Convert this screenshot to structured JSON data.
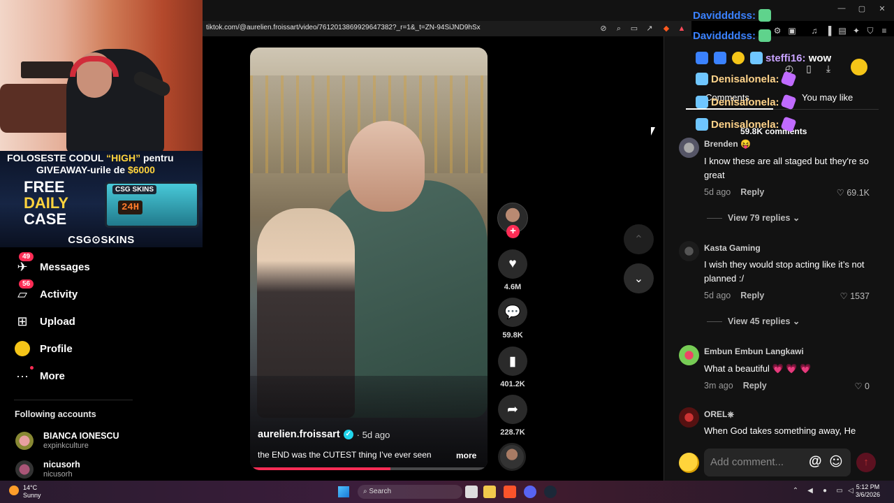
{
  "browser": {
    "url": "tiktok.com/@aurelien.froissart/video/7612013869929647382?_r=1&_t=ZN-94SiJND9hSx"
  },
  "stream_overlay": {
    "promo_line1_prefix": "FOLOSESTE CODUL ",
    "promo_code": "“HIGH”",
    "promo_line1_suffix": " pentru",
    "promo_line2_prefix": "GIVEAWAY-urile de ",
    "promo_amount": "$6000",
    "free_1": "FREE",
    "free_2": "DAILY",
    "free_3": "CASE",
    "crate_tag": "CSG SKINS",
    "crate_timer": "24H",
    "brand": "CSG⊙SKINS"
  },
  "sidebar": {
    "items": [
      {
        "label": "Messages",
        "badge": "49",
        "icon": "messages-icon"
      },
      {
        "label": "Activity",
        "badge": "56",
        "icon": "activity-icon"
      },
      {
        "label": "Upload",
        "icon": "upload-icon"
      },
      {
        "label": "Profile",
        "icon": "profile-avatar"
      },
      {
        "label": "More",
        "icon": "more-icon"
      }
    ],
    "following_title": "Following accounts",
    "following": [
      {
        "name": "BIANCA IONESCU",
        "handle": "expinkculture"
      },
      {
        "name": "nicusorh",
        "handle": "nicusorh"
      }
    ]
  },
  "video": {
    "author": "aurelien.froissart",
    "ago": "· 5d ago",
    "caption": "the END was the CUTEST thing I’ve ever seen",
    "more": "more",
    "progress": 0.59,
    "actions": {
      "likes": "4.6M",
      "comments": "59.8K",
      "saves": "401.2K",
      "shares": "228.7K"
    }
  },
  "chat_overlay": [
    {
      "user": "Daviddddss:",
      "text": "",
      "style": "u1"
    },
    {
      "user": "Daviddddss:",
      "text": "",
      "style": "u1"
    },
    {
      "user": "steffi16:",
      "text": "wow",
      "style": "u3"
    },
    {
      "user": "Denisalonela:",
      "text": "",
      "style": "u2"
    },
    {
      "user": "Denisalonela:",
      "text": "",
      "style": "u2"
    },
    {
      "user": "Denisalonela:",
      "text": "",
      "style": "u2"
    }
  ],
  "comments_panel": {
    "tab_comments": "Comments",
    "tab_like": "You may like",
    "count": "59.8K comments",
    "comments": [
      {
        "name": "Brenden 😝",
        "text": "I know these are all staged but they're so great",
        "ago": "5d ago",
        "reply": "Reply",
        "likes": "69.1K",
        "replies": "View 79 replies ⌄"
      },
      {
        "name": "Kasta Gaming",
        "text": "I wish they would stop acting like it’s not planned :/",
        "ago": "5d ago",
        "reply": "Reply",
        "likes": "1537",
        "replies": "View 45 replies ⌄"
      },
      {
        "name": "Embun Embun Langkawi",
        "text": "What a beautiful 💗 💗 💗",
        "ago": "3m ago",
        "reply": "Reply",
        "likes": "0"
      },
      {
        "name": "OREL⎈",
        "text": "When God takes something away, He"
      }
    ],
    "input_placeholder": "Add comment...",
    "at": "@",
    "emoji": "☺"
  },
  "taskbar": {
    "temp": "14°C",
    "weather": "Sunny",
    "search": "Search",
    "time": "5:12 PM",
    "date": "3/6/2026"
  },
  "colors": {
    "accent": "#fe2c55",
    "verified": "#20d5ec",
    "chat_blue": "#3b82ff"
  }
}
